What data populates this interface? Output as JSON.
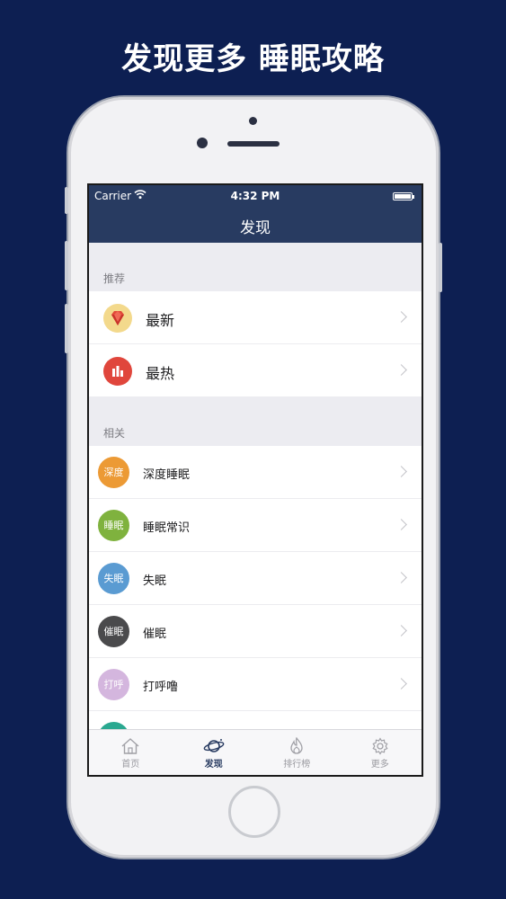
{
  "promo": {
    "headline": "发现更多 睡眠攻略"
  },
  "status_bar": {
    "carrier": "Carrier",
    "time": "4:32 PM"
  },
  "nav": {
    "title": "发现"
  },
  "sections": [
    {
      "label": "推荐",
      "items": [
        {
          "label": "最新",
          "icon": "ruby-gem-icon",
          "color": "#f3d98c"
        },
        {
          "label": "最热",
          "icon": "bar-chart-icon",
          "color": "#e0463c"
        }
      ]
    },
    {
      "label": "相关",
      "items": [
        {
          "label": "深度睡眠",
          "badge": "深度",
          "color": "#ec9a35"
        },
        {
          "label": "睡眠常识",
          "badge": "睡眠",
          "color": "#7fb23e"
        },
        {
          "label": "失眠",
          "badge": "失眠",
          "color": "#5a9bd2"
        },
        {
          "label": "催眠",
          "badge": "催眠",
          "color": "#4a4a4c"
        },
        {
          "label": "打呼噜",
          "badge": "打呼",
          "color": "#d4b6de"
        },
        {
          "label": "",
          "badge": "",
          "color": "#2aa890"
        }
      ]
    }
  ],
  "tabs": [
    {
      "label": "首页",
      "icon": "home-icon",
      "active": false
    },
    {
      "label": "发现",
      "icon": "planet-icon",
      "active": true
    },
    {
      "label": "排行榜",
      "icon": "flame-icon",
      "active": false
    },
    {
      "label": "更多",
      "icon": "gear-icon",
      "active": false
    }
  ],
  "colors": {
    "background": "#0d1f52",
    "nav": "#283b61",
    "active_tab": "#283b61"
  }
}
